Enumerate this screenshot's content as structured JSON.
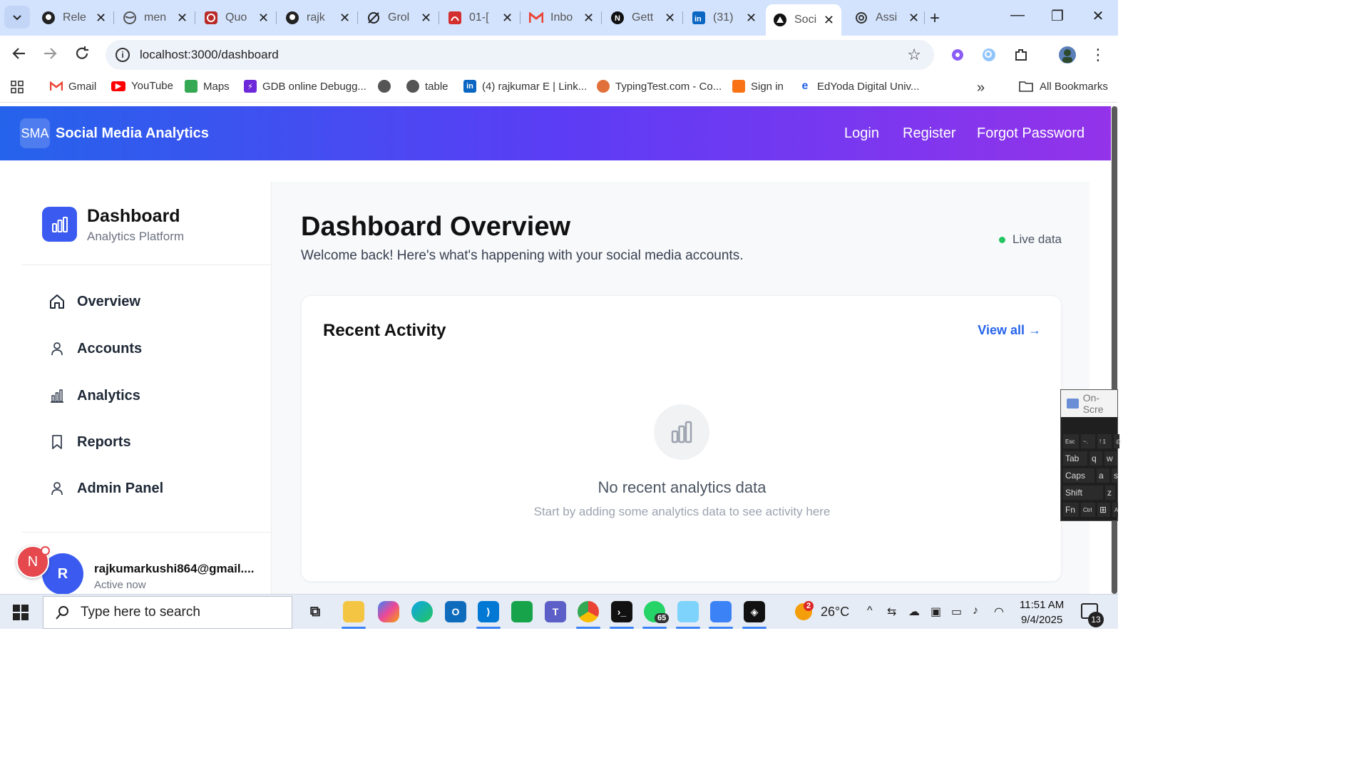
{
  "browser": {
    "tabs": [
      {
        "title": "Rele",
        "icon": "github-icon"
      },
      {
        "title": "men",
        "icon": "globe-icon"
      },
      {
        "title": "Quo",
        "icon": "quora-icon"
      },
      {
        "title": "rajk",
        "icon": "github-icon"
      },
      {
        "title": "Grol",
        "icon": "grok-icon"
      },
      {
        "title": "01-[",
        "icon": "pdf-icon"
      },
      {
        "title": "Inbo",
        "icon": "gmail-icon"
      },
      {
        "title": "Gett",
        "icon": "nextjs-icon"
      },
      {
        "title": "(31)",
        "icon": "linkedin-icon"
      },
      {
        "title": "Soci",
        "icon": "vercel-icon",
        "active": true
      },
      {
        "title": "Assi",
        "icon": "openai-icon"
      }
    ],
    "url": "localhost:3000/dashboard",
    "bookmarks": [
      {
        "label": "Gmail"
      },
      {
        "label": "YouTube"
      },
      {
        "label": "Maps"
      },
      {
        "label": "GDB online Debugg..."
      },
      {
        "label": ""
      },
      {
        "label": "table"
      },
      {
        "label": "(4) rajkumar E | Link..."
      },
      {
        "label": "TypingTest.com - Co..."
      },
      {
        "label": "Sign in"
      },
      {
        "label": "EdYoda Digital Univ..."
      }
    ],
    "bookmarks_more": "»",
    "all_bookmarks": "All Bookmarks"
  },
  "app": {
    "logo_text": "SMA",
    "title": "Social Media Analytics",
    "nav": [
      "Login",
      "Register",
      "Forgot Password"
    ],
    "header_gradient": [
      "#2563eb",
      "#5b3df5",
      "#9333ea"
    ]
  },
  "sidebar": {
    "title": "Dashboard",
    "subtitle": "Analytics Platform",
    "items": [
      {
        "label": "Overview",
        "icon": "home-icon"
      },
      {
        "label": "Accounts",
        "icon": "user-icon"
      },
      {
        "label": "Analytics",
        "icon": "bar-chart-icon"
      },
      {
        "label": "Reports",
        "icon": "bookmark-icon"
      },
      {
        "label": "Admin Panel",
        "icon": "user-icon"
      }
    ],
    "user": {
      "initial": "R",
      "email": "rajkumarkushi864@gmail....",
      "status": "Active now"
    }
  },
  "main": {
    "title": "Dashboard Overview",
    "subtitle": "Welcome back! Here's what's happening with your social media accounts.",
    "live_label": "Live data",
    "activity": {
      "title": "Recent Activity",
      "view_all": "View all →",
      "empty_title": "No recent analytics data",
      "empty_sub": "Start by adding some analytics data to see activity here"
    }
  },
  "overlay": {
    "notification_initial": "N",
    "osk_title": "On-Scre",
    "osk_keys": [
      [
        "Esc",
        "~.",
        "! 1",
        "@"
      ],
      [
        "Tab",
        "q",
        "w"
      ],
      [
        "Caps",
        "a",
        "s"
      ],
      [
        "Shift",
        "z"
      ],
      [
        "Fn",
        "Ctrl",
        "",
        "A"
      ]
    ]
  },
  "taskbar": {
    "search_placeholder": "Type here to search",
    "whatsapp_badge": "65",
    "weather_badge": "2",
    "temperature": "26°C",
    "time": "11:51 AM",
    "date": "9/4/2025",
    "notifications": "13"
  },
  "colors": {
    "accent": "#2563eb",
    "live": "#22c55e",
    "sidebar_logo": "#3b5bf0"
  }
}
